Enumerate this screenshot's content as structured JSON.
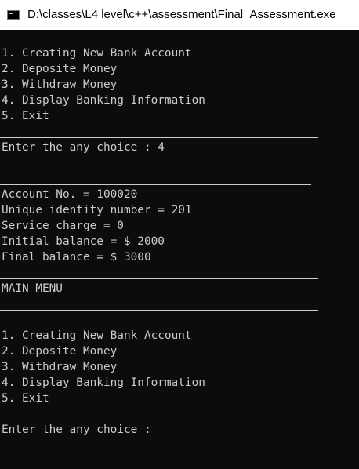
{
  "window": {
    "title": "D:\\classes\\L4 level\\c++\\assessment\\Final_Assessment.exe"
  },
  "console": {
    "menu1": [
      "1. Creating New Bank Account",
      "2. Deposite Money",
      "3. Withdraw Money",
      "4. Display Banking Information",
      "5. Exit"
    ],
    "prompt1": "Enter the any choice : 4",
    "info": [
      "Account No. = 100020",
      "Unique identity number = 201",
      "Service charge = 0",
      "Initial balance = $ 2000",
      "Final balance = $ 3000"
    ],
    "main_menu_label": "MAIN MENU",
    "menu2": [
      "1. Creating New Bank Account",
      "2. Deposite Money",
      "3. Withdraw Money",
      "4. Display Banking Information",
      "5. Exit"
    ],
    "prompt2": "Enter the any choice :"
  }
}
